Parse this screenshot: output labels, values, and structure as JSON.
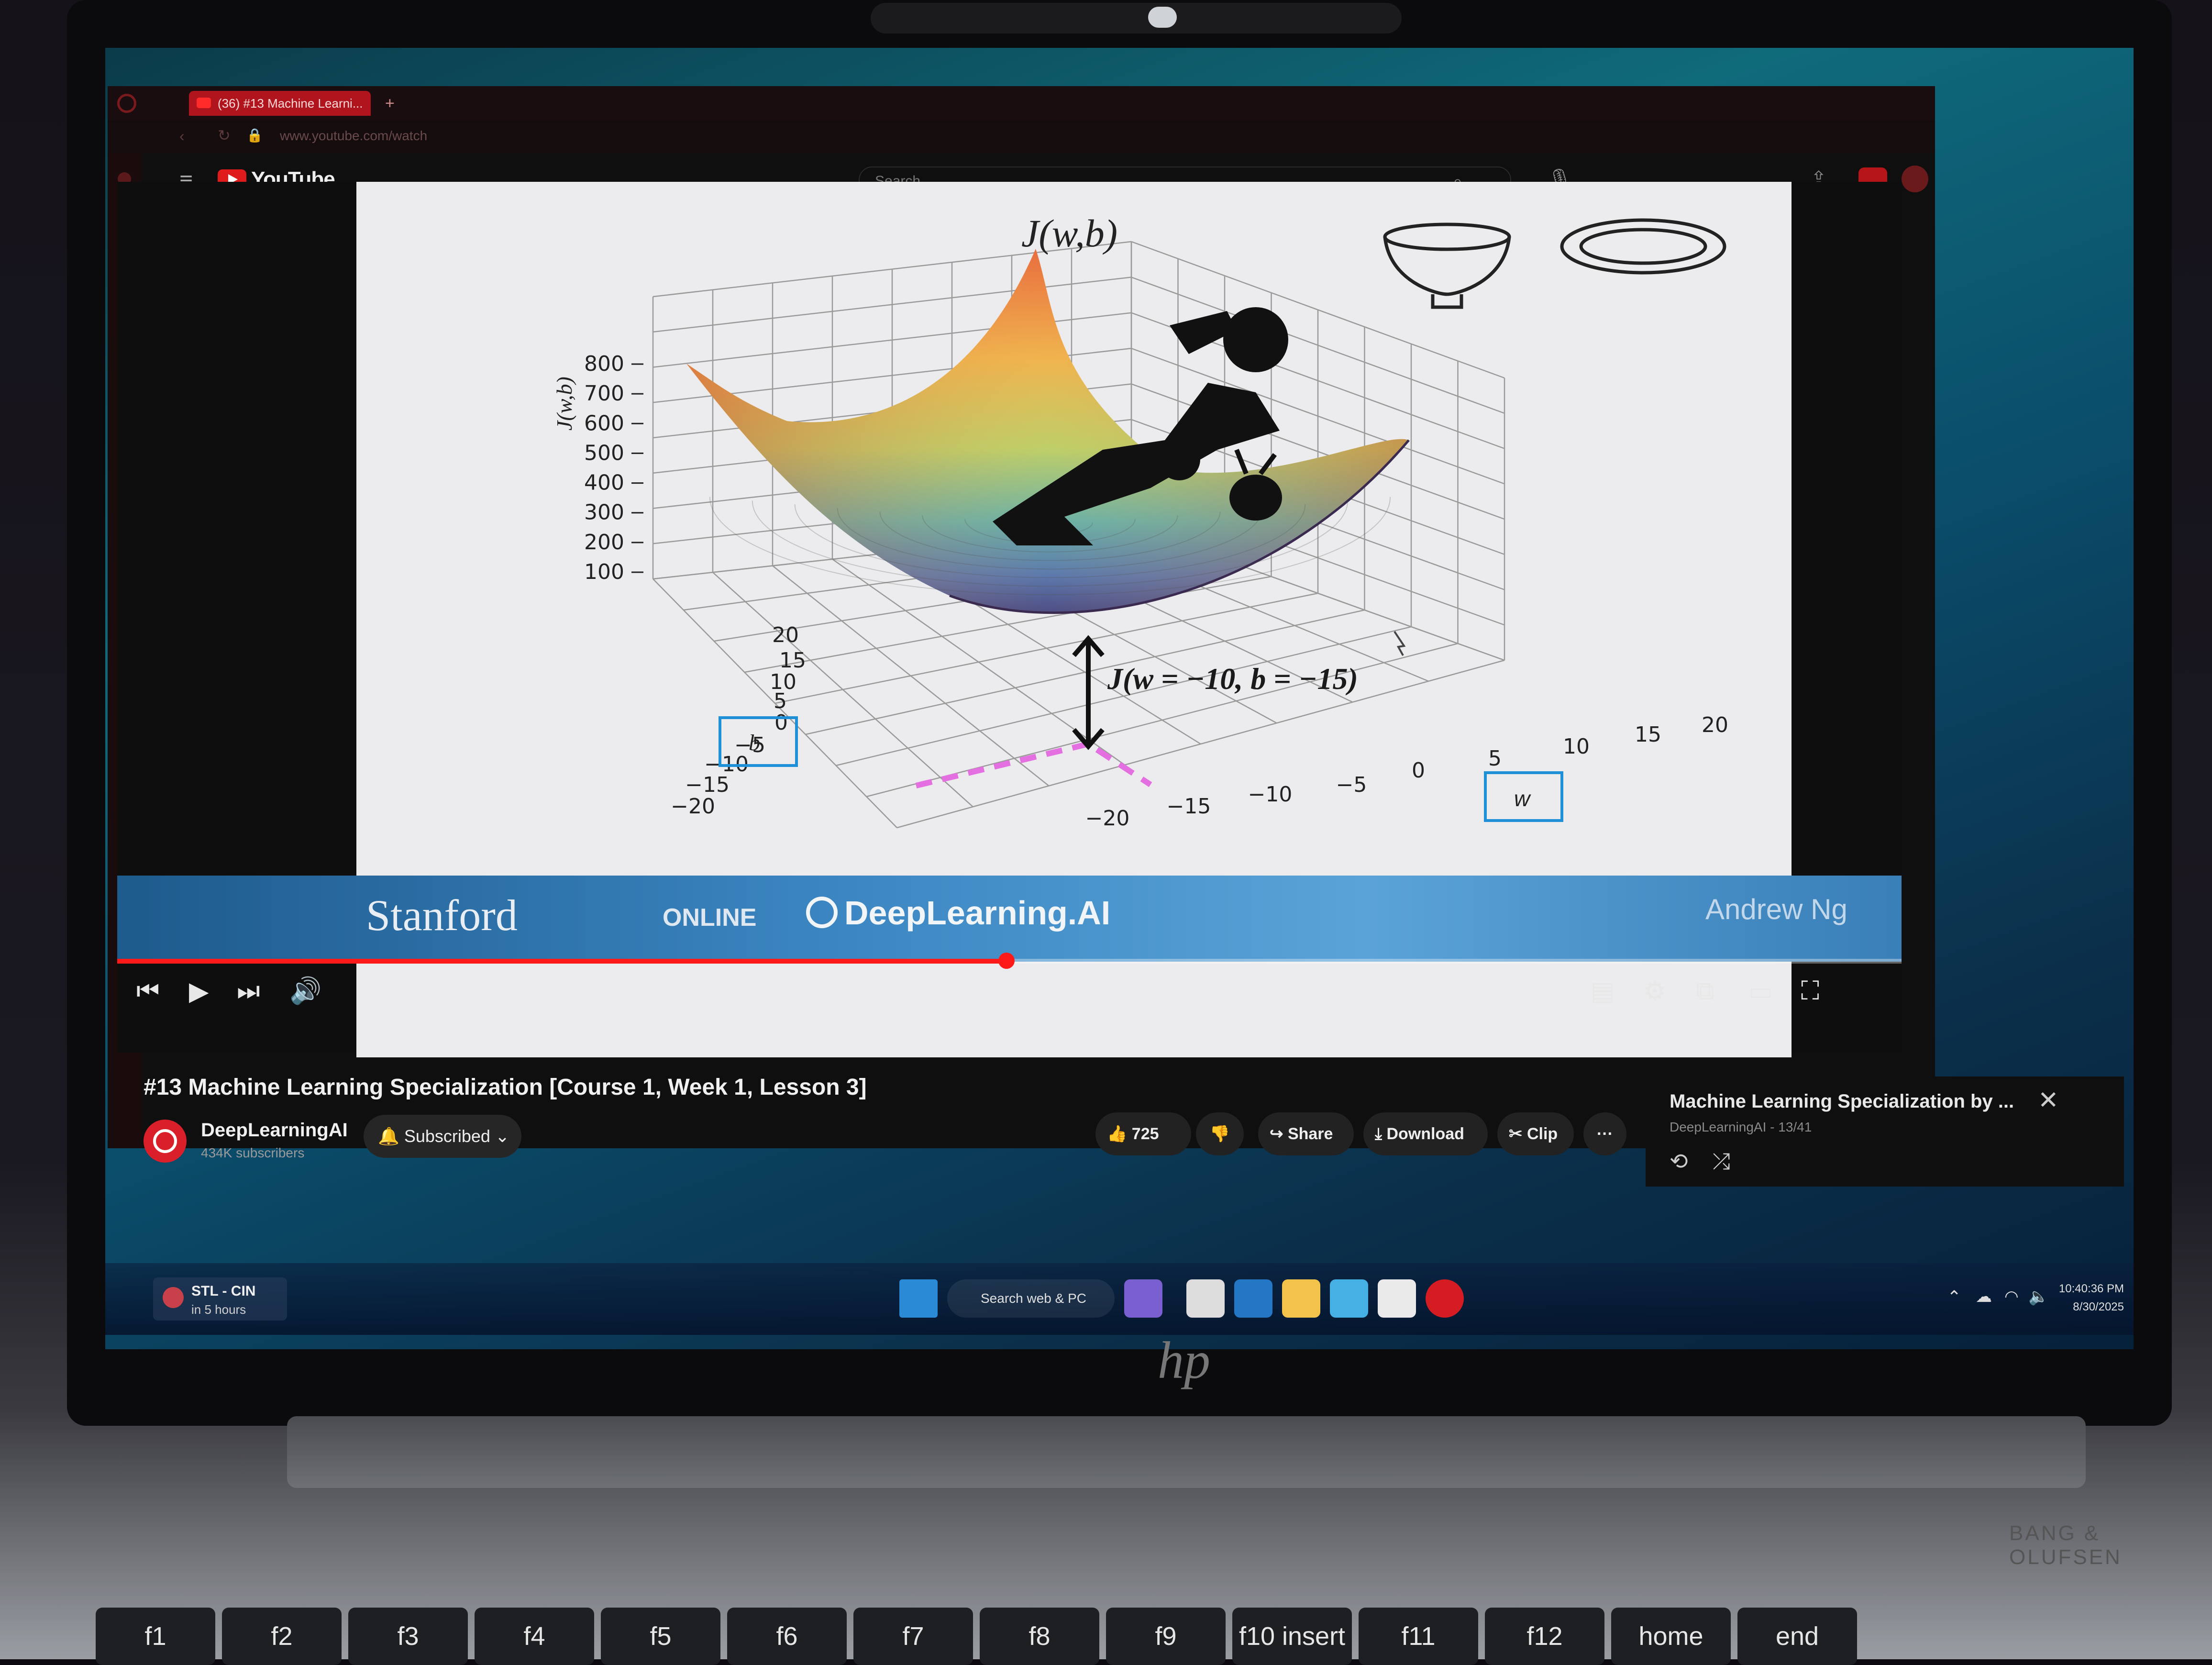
{
  "browser": {
    "tab_title": "(36) #13 Machine Learni...",
    "new_tab": "+",
    "url": "www.youtube.com/watch"
  },
  "youtube": {
    "logo_text": "YouTube",
    "search_placeholder": "Search"
  },
  "video": {
    "slide_title": "J(w,b)",
    "annotation": "J(w = −10, b = −15)",
    "brand_stanford": "Stanford",
    "brand_online": "ONLINE",
    "brand_dlai": "DeepLearning.AI",
    "instructor": "Andrew Ng",
    "progress": 0.5
  },
  "chart_data": {
    "type": "surface",
    "title": "J(w,b)",
    "zlabel": "J(w,b)",
    "z_ticks": [
      "100",
      "200",
      "300",
      "400",
      "500",
      "600",
      "700",
      "800"
    ],
    "w_label": "w",
    "b_label": "b",
    "w_ticks": [
      "−20",
      "−15",
      "−10",
      "−5",
      "0",
      "5",
      "10",
      "15",
      "20"
    ],
    "b_ticks": [
      "−20",
      "−15",
      "−10",
      "−5",
      "0",
      "5",
      "10",
      "15",
      "20"
    ],
    "highlight_point": {
      "w": -10,
      "b": -15
    },
    "grid": true
  },
  "info": {
    "title": "#13 Machine Learning Specialization [Course 1, Week 1, Lesson 3]",
    "channel": "DeepLearningAI",
    "subscribers": "434K subscribers",
    "subscribe_state": "Subscribed",
    "likes": "725",
    "share": "Share",
    "download": "Download",
    "clip": "Clip",
    "more": "···"
  },
  "miniplayer": {
    "title": "Machine Learning Specialization by ...",
    "subtitle": "DeepLearningAI - 13/41"
  },
  "taskbar": {
    "weather_title": "STL - CIN",
    "weather_sub": "in 5 hours",
    "search": "Search web & PC",
    "time": "10:40:36 PM",
    "date": "8/30/2025"
  },
  "laptop": {
    "brand_label": "BANG & OLUFSEN",
    "keys": [
      "f1",
      "f2",
      "f3",
      "f4",
      "f5",
      "f6",
      "f7",
      "f8",
      "f9",
      "f10 insert",
      "f11",
      "f12",
      "home",
      "end"
    ]
  },
  "colors": {
    "youtube_red": "#ff0000",
    "progress": "#ff1a1a",
    "highlight_dash": "#e36fe0",
    "label_box": "#1f8fd6"
  }
}
